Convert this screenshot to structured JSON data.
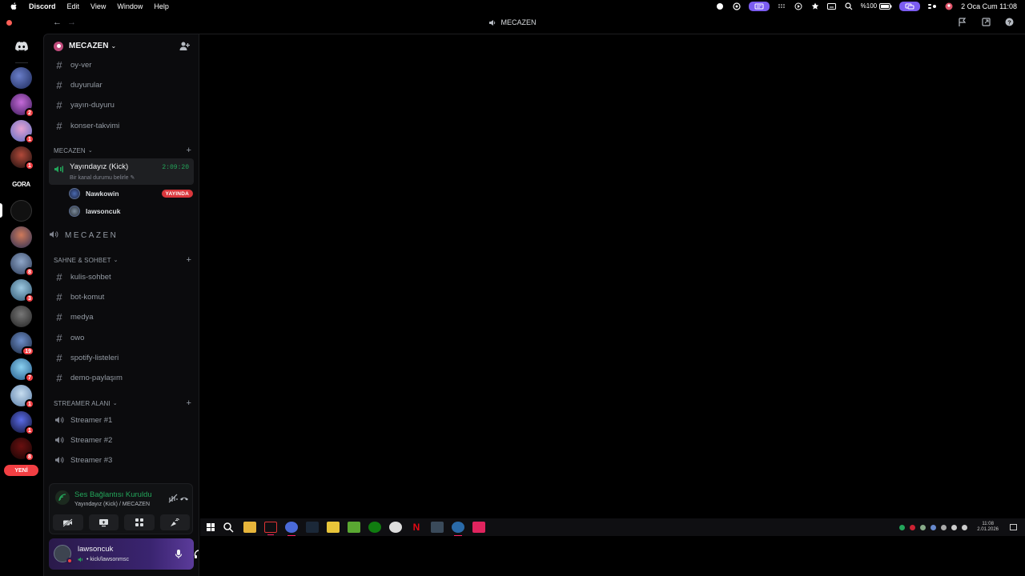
{
  "menubar": {
    "app_name": "Discord",
    "items": [
      "Edit",
      "View",
      "Window",
      "Help"
    ],
    "battery": "%100",
    "datetime": "2 Oca Cum  11:08"
  },
  "titlebar": {
    "channel_title": "MECAZEN"
  },
  "rail": {
    "servers": [
      {
        "badge": ""
      },
      {
        "badge": "2"
      },
      {
        "badge": "1"
      },
      {
        "badge": "1"
      },
      {
        "label": "GORA"
      },
      {
        "badge": ""
      },
      {
        "badge": ""
      },
      {
        "badge": "8"
      },
      {
        "badge": "3"
      },
      {
        "badge": ""
      },
      {
        "badge": "19"
      },
      {
        "badge": "7"
      },
      {
        "badge": "1"
      },
      {
        "badge": "1"
      },
      {
        "badge": "8"
      }
    ],
    "new_label": "YENİ"
  },
  "guild": {
    "name": "MECAZEN"
  },
  "channels_top": [
    {
      "name": "oy-ver"
    },
    {
      "name": "duyurular"
    },
    {
      "name": "yayın-duyuru"
    },
    {
      "name": "konser-takvimi"
    }
  ],
  "category_mecazen": "MECAZEN",
  "voice_channel": {
    "name": "Yayındayız (Kick)",
    "status_hint": "Bir kanal durumu belirle",
    "timer": "2:09:20",
    "users": [
      {
        "name": "Nawkowin",
        "badge": "YAYINDA"
      },
      {
        "name": "lawsoncuk",
        "badge": ""
      }
    ]
  },
  "stage_channel": "MECAZEN",
  "category_sahne": "SAHNE & SOHBET",
  "channels_sahne": [
    {
      "name": "kulis-sohbet"
    },
    {
      "name": "bot-komut"
    },
    {
      "name": "medya"
    },
    {
      "name": "owo"
    },
    {
      "name": "spotify-listeleri"
    },
    {
      "name": "demo-paylaşım"
    }
  ],
  "category_streamer": "STREAMER ALANI",
  "channels_streamer": [
    {
      "name": "Streamer #1"
    },
    {
      "name": "Streamer #2"
    },
    {
      "name": "Streamer #3"
    }
  ],
  "rtc": {
    "title": "Ses Bağlantısı Kuruldu",
    "subtitle": "Yayındayız (Kick) / MECAZEN"
  },
  "user": {
    "name": "lawsoncuk",
    "status": "• kick/lawsonmsc"
  },
  "taskbar": {
    "clock_time": "11:08",
    "clock_date": "2.01.2026"
  },
  "colors": {
    "accent": "#5865f2",
    "green": "#23a55a",
    "red": "#f23f43",
    "live_red": "#da373c"
  }
}
